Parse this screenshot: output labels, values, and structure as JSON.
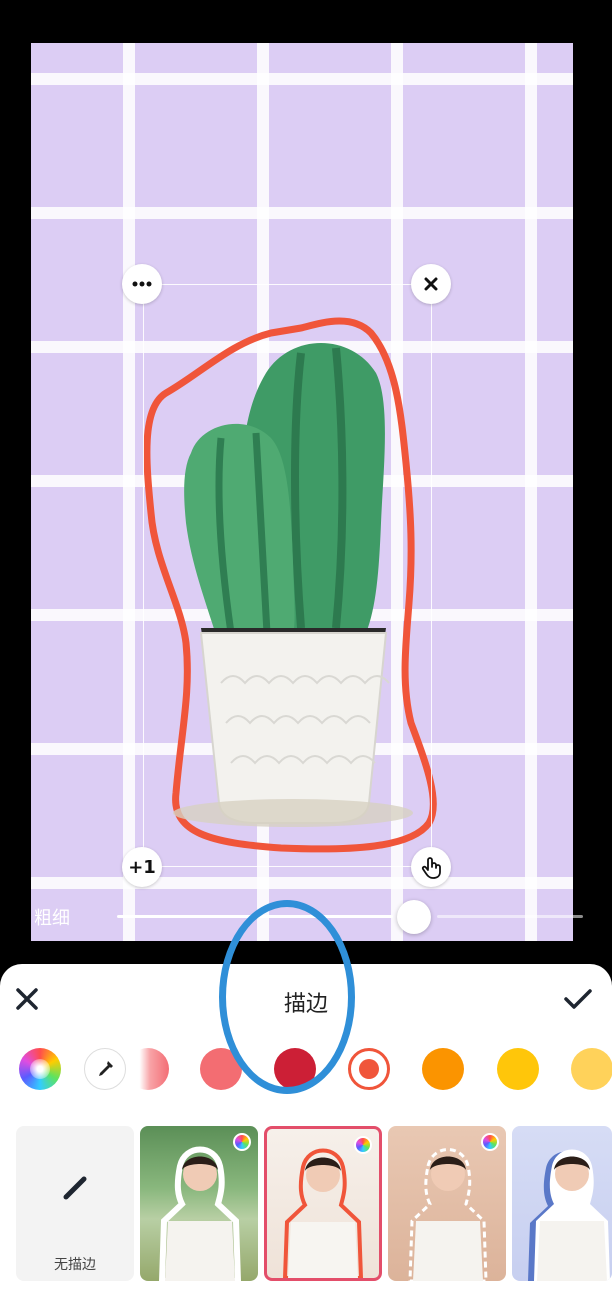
{
  "editor": {
    "stroke_thickness_label": "粗细",
    "stroke_thickness_level": 0.67,
    "handle_add_label": "+1"
  },
  "panel": {
    "title": "描边",
    "none_preset_label": "无描边"
  },
  "colors": {
    "canvas_background": "#dccdf4",
    "selected_stroke": "#f0553a",
    "swatches": [
      "rainbow",
      "eyedropper",
      "#f8a3a7",
      "#f36d72",
      "#cc1f36",
      "#f0553a",
      "#fb9400",
      "#ffc60a",
      "#ffd25a"
    ],
    "annotation_ellipse": "#2f8fd8"
  },
  "icons": {
    "close": "close-icon",
    "confirm": "check-icon",
    "more": "more-icon",
    "delete": "close-icon",
    "touch": "hand-pointer-icon",
    "eyedropper": "eyedropper-icon",
    "no_stroke": "pencil-icon"
  }
}
